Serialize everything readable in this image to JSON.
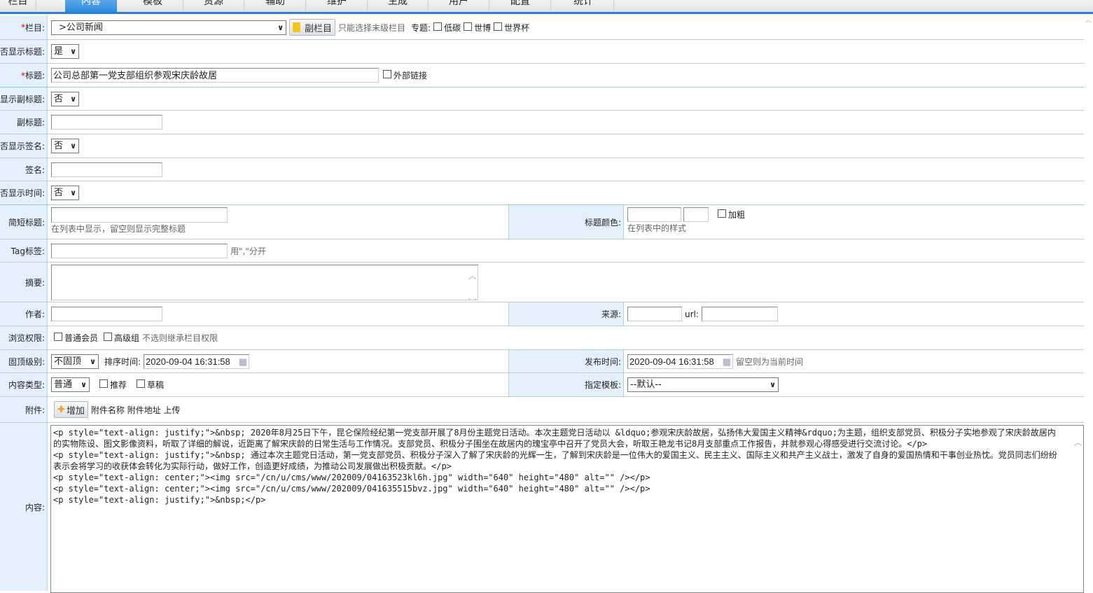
{
  "tabs": [
    "栏目",
    "内容",
    "模板",
    "资源",
    "辅助",
    "维护",
    "生成",
    "用户",
    "配置",
    "统计"
  ],
  "form": {
    "channel": {
      "label": "栏目:",
      "value": ">公司新闻",
      "sub_button": "副栏目",
      "hint": "只能选择末级栏目",
      "topic_label": "专题:",
      "topics": [
        "低碳",
        "世博",
        "世界杯"
      ]
    },
    "show_title": {
      "label": "是否显示标题:",
      "value": "是"
    },
    "title": {
      "label": "标题:",
      "value": "公司总部第一党支部组织参观宋庆龄故居",
      "external": "外部链接"
    },
    "show_subtitle": {
      "label": "是否显示副标题:",
      "value": "否"
    },
    "subtitle": {
      "label": "副标题:",
      "value": ""
    },
    "show_sign": {
      "label": "是否显示签名:",
      "value": "否"
    },
    "sign": {
      "label": "签名:",
      "value": ""
    },
    "show_time": {
      "label": "是否显示时间:",
      "value": "否"
    },
    "short_title": {
      "label": "简短标题:",
      "hint": "在列表中显示，留空则显示完整标题"
    },
    "title_color": {
      "label": "标题颜色:",
      "bold": "加粗",
      "hint": "在列表中的样式"
    },
    "tags": {
      "label": "Tag标签:",
      "hint": "用\",\"分开"
    },
    "summary": {
      "label": "摘要:"
    },
    "author": {
      "label": "作者:"
    },
    "source": {
      "label": "来源:",
      "url_label": "url:"
    },
    "view_perm": {
      "label": "浏览权限:",
      "options": [
        "普通会员",
        "高级组"
      ],
      "hint": "不选则继承栏目权限"
    },
    "top_level": {
      "label": "固顶级别:",
      "value": "不固顶",
      "sort_label": "排序时间:",
      "sort_value": "2020-09-04 16:31:58"
    },
    "publish": {
      "label": "发布时间:",
      "value": "2020-09-04 16:31:58",
      "hint": "留空则为当前时间"
    },
    "content_type": {
      "label": "内容类型:",
      "value": "普通",
      "options": [
        "推荐",
        "草稿"
      ]
    },
    "template": {
      "label": "指定模板:",
      "value": "--默认--"
    },
    "attach": {
      "label": "附件:",
      "button": "增加",
      "cols": "附件名称 附件地址 上传"
    },
    "content": {
      "label": "内容:",
      "value": "<p style=\"text-align: justify;\">&nbsp; 2020年8月25日下午，昆仑保险经纪第一党支部开展了8月份主题党日活动。本次主题党日活动以 &ldquo;参观宋庆龄故居，弘扬伟大爱国主义精神&rdquo;为主题，组织支部党员、积极分子实地参观了宋庆龄故居内的实物陈设、图文影像资料，听取了详细的解说，近距离了解宋庆龄的日常生活与工作情况。支部党员、积极分子围坐在故居内的瑰宝亭中召开了党员大会，听取王艳龙书记8月支部重点工作报告，并就参观心得感受进行交流讨论。</p>\n<p style=\"text-align: justify;\">&nbsp; 通过本次主题党日活动，第一党支部党员、积极分子深入了解了宋庆龄的光辉一生，了解到宋庆龄是一位伟大的爱国主义、民主主义、国际主义和共产主义战士，激发了自身的爱国热情和干事创业热忱。党员同志们纷纷表示会将学习的收获体会转化为实际行动，做好工作，创造更好成绩，为推动公司发展做出积极贡献。</p>\n<p style=\"text-align: center;\"><img src=\"/cn/u/cms/www/202009/04163523kl6h.jpg\" width=\"640\" height=\"480\" alt=\"\" /></p>\n<p style=\"text-align: center;\"><img src=\"/cn/u/cms/www/202009/041635515bvz.jpg\" width=\"640\" height=\"480\" alt=\"\" /></p>\n<p style=\"text-align: justify;\">&nbsp;</p>"
    }
  }
}
